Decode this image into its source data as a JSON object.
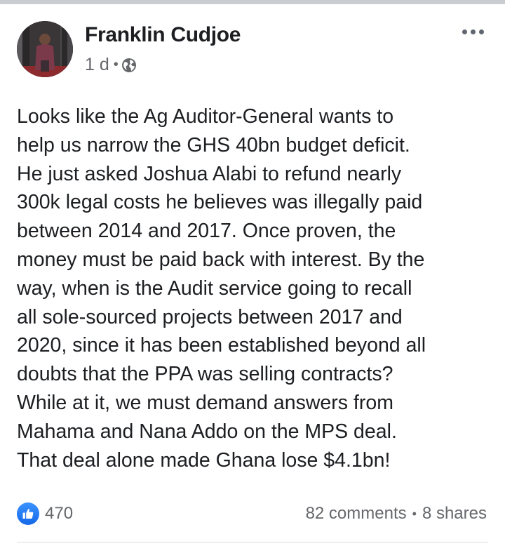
{
  "post": {
    "author": "Franklin Cudjoe",
    "time": "1 d",
    "meta_separator": "•",
    "privacy_icon": "globe-icon",
    "more_icon": "more-options-icon",
    "body_lines": [
      "Looks like the Ag Auditor-General wants to",
      "help us narrow the GHS 40bn budget deficit.",
      "He just asked Joshua Alabi to refund nearly",
      "300k legal costs he believes was illegally paid",
      "between 2014 and 2017. Once proven, the",
      "money must be paid back with interest. By the",
      "way, when is the Audit service going to recall",
      "all sole-sourced projects between 2017 and",
      "2020, since it has been established beyond all",
      "doubts that the PPA was selling contracts?",
      "While at it, we must demand answers from",
      "Mahama and Nana Addo on the MPS deal.",
      "That deal alone made Ghana lose $4.1bn!"
    ]
  },
  "footer": {
    "reaction_icon": "like-icon",
    "reaction_count": "470",
    "comments": "82 comments",
    "separator": "•",
    "shares": "8 shares"
  },
  "colors": {
    "text": "#1c1e21",
    "secondary": "#65676b",
    "like_blue": "#1877f2"
  }
}
